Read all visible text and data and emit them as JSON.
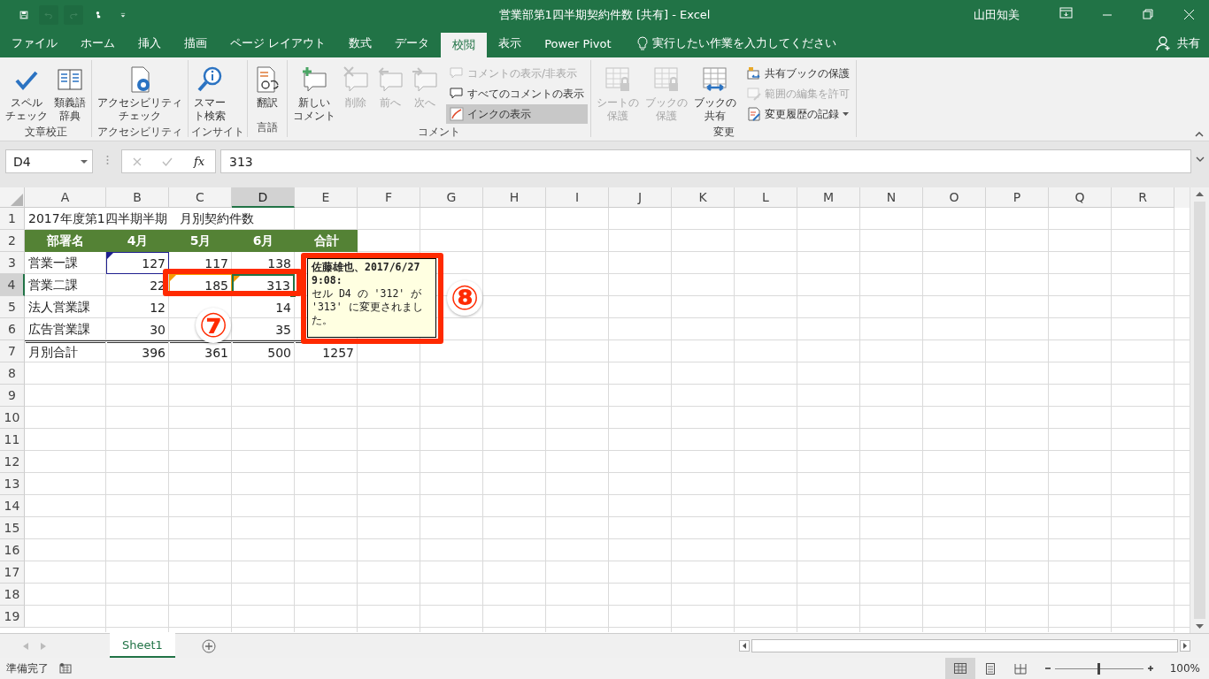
{
  "title_bar": {
    "title": "営業部第1四半期契約件数 [共有] - Excel",
    "user": "山田知美"
  },
  "quick_access": [
    {
      "kind": "save",
      "disabled": false
    },
    {
      "kind": "undo",
      "disabled": true
    },
    {
      "kind": "redo",
      "disabled": true
    },
    {
      "kind": "touch",
      "disabled": false
    },
    {
      "kind": "customize",
      "disabled": false
    }
  ],
  "tabs": [
    {
      "label": "ファイル",
      "selected": false
    },
    {
      "label": "ホーム",
      "selected": false
    },
    {
      "label": "挿入",
      "selected": false
    },
    {
      "label": "描画",
      "selected": false
    },
    {
      "label": "ページ レイアウト",
      "selected": false
    },
    {
      "label": "数式",
      "selected": false
    },
    {
      "label": "データ",
      "selected": false
    },
    {
      "label": "校閲",
      "selected": true
    },
    {
      "label": "表示",
      "selected": false
    },
    {
      "label": "Power Pivot",
      "selected": false
    }
  ],
  "tell_me": {
    "placeholder": "実行したい作業を入力してください"
  },
  "share": "共有",
  "ribbon": {
    "groups": [
      {
        "label": "文章校正",
        "large": [
          {
            "kind": "spell",
            "lines": [
              "スペル",
              "チェック"
            ],
            "disabled": false
          },
          {
            "kind": "thesaurus",
            "lines": [
              "類義語",
              "辞典"
            ],
            "disabled": false
          }
        ]
      },
      {
        "label": "アクセシビリティ",
        "large": [
          {
            "kind": "accessibility",
            "lines": [
              "アクセシビリティ",
              "チェック"
            ],
            "disabled": false
          }
        ]
      },
      {
        "label": "インサイト",
        "large": [
          {
            "kind": "lookup",
            "lines": [
              "スマー",
              "ト検索"
            ],
            "disabled": false
          }
        ]
      },
      {
        "label": "言語",
        "large": [
          {
            "kind": "translate",
            "lines": [
              "翻訳"
            ],
            "disabled": false
          }
        ]
      },
      {
        "label": "コメント",
        "large": [
          {
            "kind": "new-comment",
            "lines": [
              "新しい",
              "コメント"
            ],
            "disabled": false
          },
          {
            "kind": "delete-comment",
            "lines": [
              "削除"
            ],
            "disabled": true
          },
          {
            "kind": "prev-comment",
            "lines": [
              "前へ"
            ],
            "disabled": true
          },
          {
            "kind": "next-comment",
            "lines": [
              "次へ"
            ],
            "disabled": true
          }
        ],
        "small": [
          {
            "kind": "comment",
            "label": "コメントの表示/非表示",
            "disabled": true,
            "pressed": false,
            "dropdown": false
          },
          {
            "kind": "comments",
            "label": "すべてのコメントの表示",
            "disabled": false,
            "pressed": false,
            "dropdown": false
          },
          {
            "kind": "ink",
            "label": "インクの表示",
            "disabled": false,
            "pressed": true,
            "dropdown": false
          }
        ]
      },
      {
        "label": "変更",
        "large": [
          {
            "kind": "protect-sheet",
            "lines": [
              "シートの",
              "保護"
            ],
            "disabled": true
          },
          {
            "kind": "protect-book",
            "lines": [
              "ブックの",
              "保護"
            ],
            "disabled": true
          },
          {
            "kind": "share-book",
            "lines": [
              "ブックの",
              "共有"
            ],
            "disabled": false
          }
        ],
        "small": [
          {
            "kind": "lock-share",
            "label": "共有ブックの保護",
            "disabled": false,
            "pressed": false,
            "dropdown": false
          },
          {
            "kind": "edit-range",
            "label": "範囲の編集を許可",
            "disabled": true,
            "pressed": false,
            "dropdown": false
          },
          {
            "kind": "track",
            "label": "変更履歴の記録",
            "disabled": false,
            "pressed": false,
            "dropdown": true
          }
        ]
      }
    ]
  },
  "formula_bar": {
    "name_box": "D4",
    "function_button": "fx",
    "value": "313"
  },
  "sheet": {
    "columns": [
      {
        "label": "A",
        "selected": false
      },
      {
        "label": "B",
        "selected": false
      },
      {
        "label": "C",
        "selected": false
      },
      {
        "label": "D",
        "selected": true
      },
      {
        "label": "E",
        "selected": false
      },
      {
        "label": "F",
        "selected": false
      },
      {
        "label": "G",
        "selected": false
      },
      {
        "label": "H",
        "selected": false
      },
      {
        "label": "I",
        "selected": false
      },
      {
        "label": "J",
        "selected": false
      },
      {
        "label": "K",
        "selected": false
      },
      {
        "label": "L",
        "selected": false
      },
      {
        "label": "M",
        "selected": false
      },
      {
        "label": "N",
        "selected": false
      },
      {
        "label": "O",
        "selected": false
      },
      {
        "label": "P",
        "selected": false
      },
      {
        "label": "Q",
        "selected": false
      },
      {
        "label": "R",
        "selected": false
      }
    ],
    "rows": [
      {
        "label": "1",
        "selected": false,
        "kind": "title",
        "cells": [
          {
            "text": "2017年度第1四半期半期　月別契約件数",
            "selected": false
          }
        ]
      },
      {
        "label": "2",
        "selected": false,
        "kind": "header",
        "cells": [
          {
            "text": "部署名",
            "selected": false
          },
          {
            "text": "4月",
            "selected": false
          },
          {
            "text": "5月",
            "selected": false
          },
          {
            "text": "6月",
            "selected": false
          },
          {
            "text": "合計",
            "selected": false
          }
        ]
      },
      {
        "label": "3",
        "selected": false,
        "kind": "data",
        "cells": [
          {
            "text": "営業一課",
            "selected": false
          },
          {
            "text": "127",
            "selected": false,
            "color": "#1f1f8f"
          },
          {
            "text": "117",
            "selected": false
          },
          {
            "text": "138",
            "selected": false
          },
          null
        ]
      },
      {
        "label": "4",
        "selected": true,
        "kind": "data",
        "cells": [
          {
            "text": "営業二課",
            "selected": false
          },
          {
            "text": "22",
            "selected": false
          },
          {
            "text": "185",
            "selected": false,
            "color": "#f59b00"
          },
          {
            "text": "313",
            "selected": true,
            "color": "#f59b00"
          },
          null
        ]
      },
      {
        "label": "5",
        "selected": false,
        "kind": "data",
        "cells": [
          {
            "text": "法人営業課",
            "selected": false
          },
          {
            "text": "12",
            "selected": false
          },
          null,
          {
            "text": "14",
            "selected": false
          },
          null
        ]
      },
      {
        "label": "6",
        "selected": false,
        "kind": "data",
        "cells": [
          {
            "text": "広告営業課",
            "selected": false
          },
          {
            "text": "30",
            "selected": false
          },
          null,
          {
            "text": "35",
            "selected": false
          },
          null
        ]
      },
      {
        "label": "7",
        "selected": false,
        "kind": "total",
        "cells": [
          {
            "text": "月別合計",
            "selected": false
          },
          {
            "text": "396",
            "selected": false
          },
          {
            "text": "361",
            "selected": false
          },
          {
            "text": "500",
            "selected": false
          },
          {
            "text": "1257",
            "selected": false
          }
        ]
      },
      {
        "label": "8",
        "selected": false,
        "kind": "data"
      },
      {
        "label": "9",
        "selected": false,
        "kind": "data"
      },
      {
        "label": "10",
        "selected": false,
        "kind": "data"
      },
      {
        "label": "11",
        "selected": false,
        "kind": "data"
      },
      {
        "label": "12",
        "selected": false,
        "kind": "data"
      },
      {
        "label": "13",
        "selected": false,
        "kind": "data"
      },
      {
        "label": "14",
        "selected": false,
        "kind": "data"
      },
      {
        "label": "15",
        "selected": false,
        "kind": "data"
      },
      {
        "label": "16",
        "selected": false,
        "kind": "data"
      },
      {
        "label": "17",
        "selected": false,
        "kind": "data"
      },
      {
        "label": "18",
        "selected": false,
        "kind": "data"
      },
      {
        "label": "19",
        "selected": false,
        "kind": "data"
      }
    ]
  },
  "comment": {
    "author_line": "佐藤雄也、2017/6/27 9:08:",
    "text": "セル D4 の '312' が '313' に変更されました。"
  },
  "callouts": [
    {
      "label": "⑦"
    },
    {
      "label": "⑧"
    }
  ],
  "sheet_tabs": [
    {
      "label": "Sheet1",
      "selected": true
    }
  ],
  "status_bar": {
    "text": "準備完了",
    "views": [
      {
        "kind": "normal",
        "selected": true
      },
      {
        "kind": "page-layout",
        "selected": false
      },
      {
        "kind": "page-break",
        "selected": false
      }
    ],
    "zoom": {
      "level": 0.5,
      "reading": "100%"
    }
  }
}
